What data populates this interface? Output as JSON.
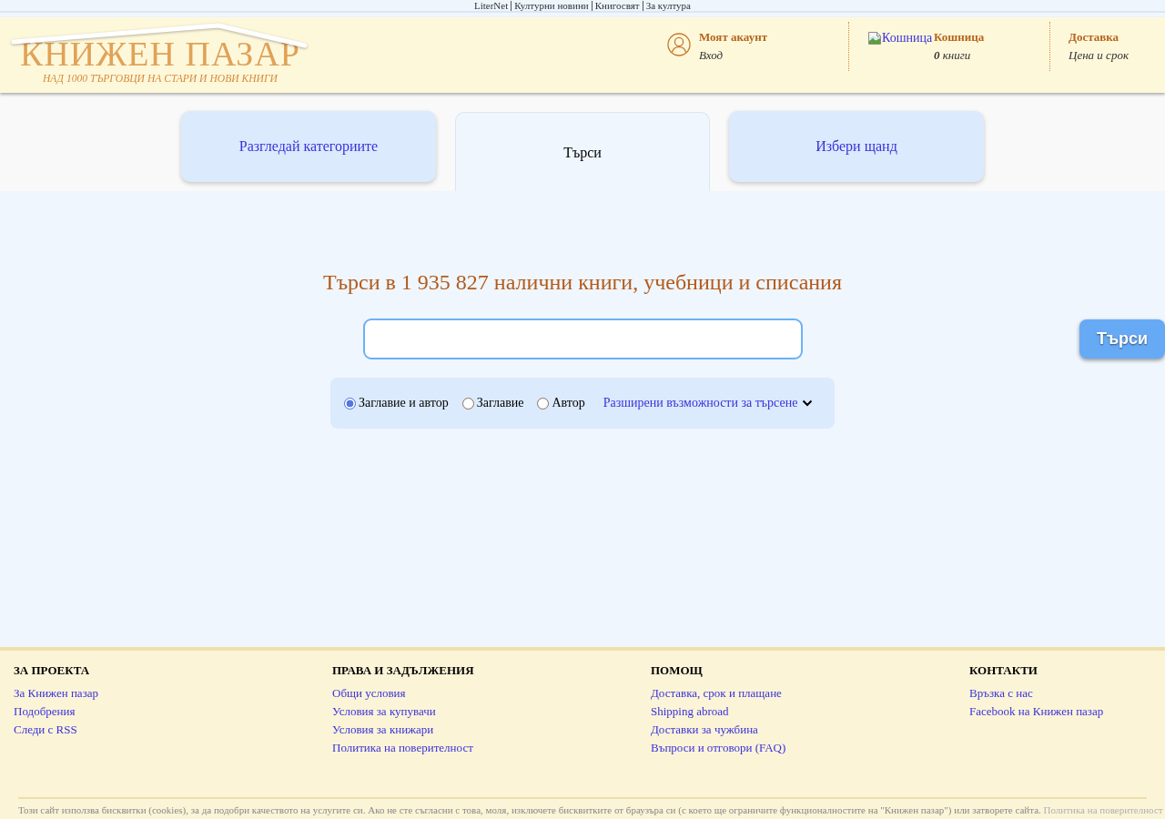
{
  "top_links": [
    "LiterNet",
    "Културни новини",
    "Книгосвят",
    "За култура"
  ],
  "header": {
    "logo": {
      "title": "КНИЖЕН ПАЗАР",
      "tagline": "НАД 1000 ТЪРГОВЦИ НА СТАРИ И НОВИ КНИГИ"
    },
    "account": {
      "title": "Моят акаунт",
      "link": "Вход"
    },
    "cart": {
      "image_alt": "Кошница",
      "title": "Кошница",
      "count": "**0** книги"
    },
    "delivery": {
      "title": "Доставка",
      "link": "Цена и срок"
    }
  },
  "tabs": [
    {
      "label": "Разгледай категориите",
      "selected": false
    },
    {
      "label": "Търси",
      "selected": true
    },
    {
      "label": "Избери щанд",
      "selected": false
    }
  ],
  "search": {
    "heading": "Търси в 1 935 827 налични книги, учебници и списания",
    "button": "Търси",
    "options": [
      {
        "label": "Заглавие и автор",
        "selected": true
      },
      {
        "label": "Заглавие",
        "selected": false
      },
      {
        "label": "Автор",
        "selected": false
      }
    ],
    "advanced_link": "Разширени възможности за търсене"
  },
  "footer": {
    "columns": [
      {
        "heading": "ЗА ПРОЕКТА",
        "links": [
          "За Книжен пазар",
          "Подобрения",
          "Следи с RSS"
        ]
      },
      {
        "heading": "ПРАВА И ЗАДЪЛЖЕНИЯ",
        "links": [
          "Общи условия",
          "Условия за купувачи",
          "Условия за книжари",
          "Политика на поверителност"
        ]
      },
      {
        "heading": "ПОМОЩ",
        "links": [
          "Доставка, срок и плащане",
          "Shipping abroad",
          "Доставки за чужбина",
          "Въпроси и отговори (FAQ)"
        ]
      },
      {
        "heading": "КОНТАКТИ",
        "links": [
          "Връзка с нас",
          "Facebook на Книжен пазар"
        ]
      }
    ],
    "cookie_notice": {
      "text": "Този сайт използва бисквитки (cookies), за да подобри качеството на услугите си. Ако не сте съгласни с това, моля, изключете бисквитките от браузъра си (с което ще ограничите функционалностите на \"Книжен пазар\") или затворете сайта.",
      "link": "Политика на поверителност"
    }
  }
}
